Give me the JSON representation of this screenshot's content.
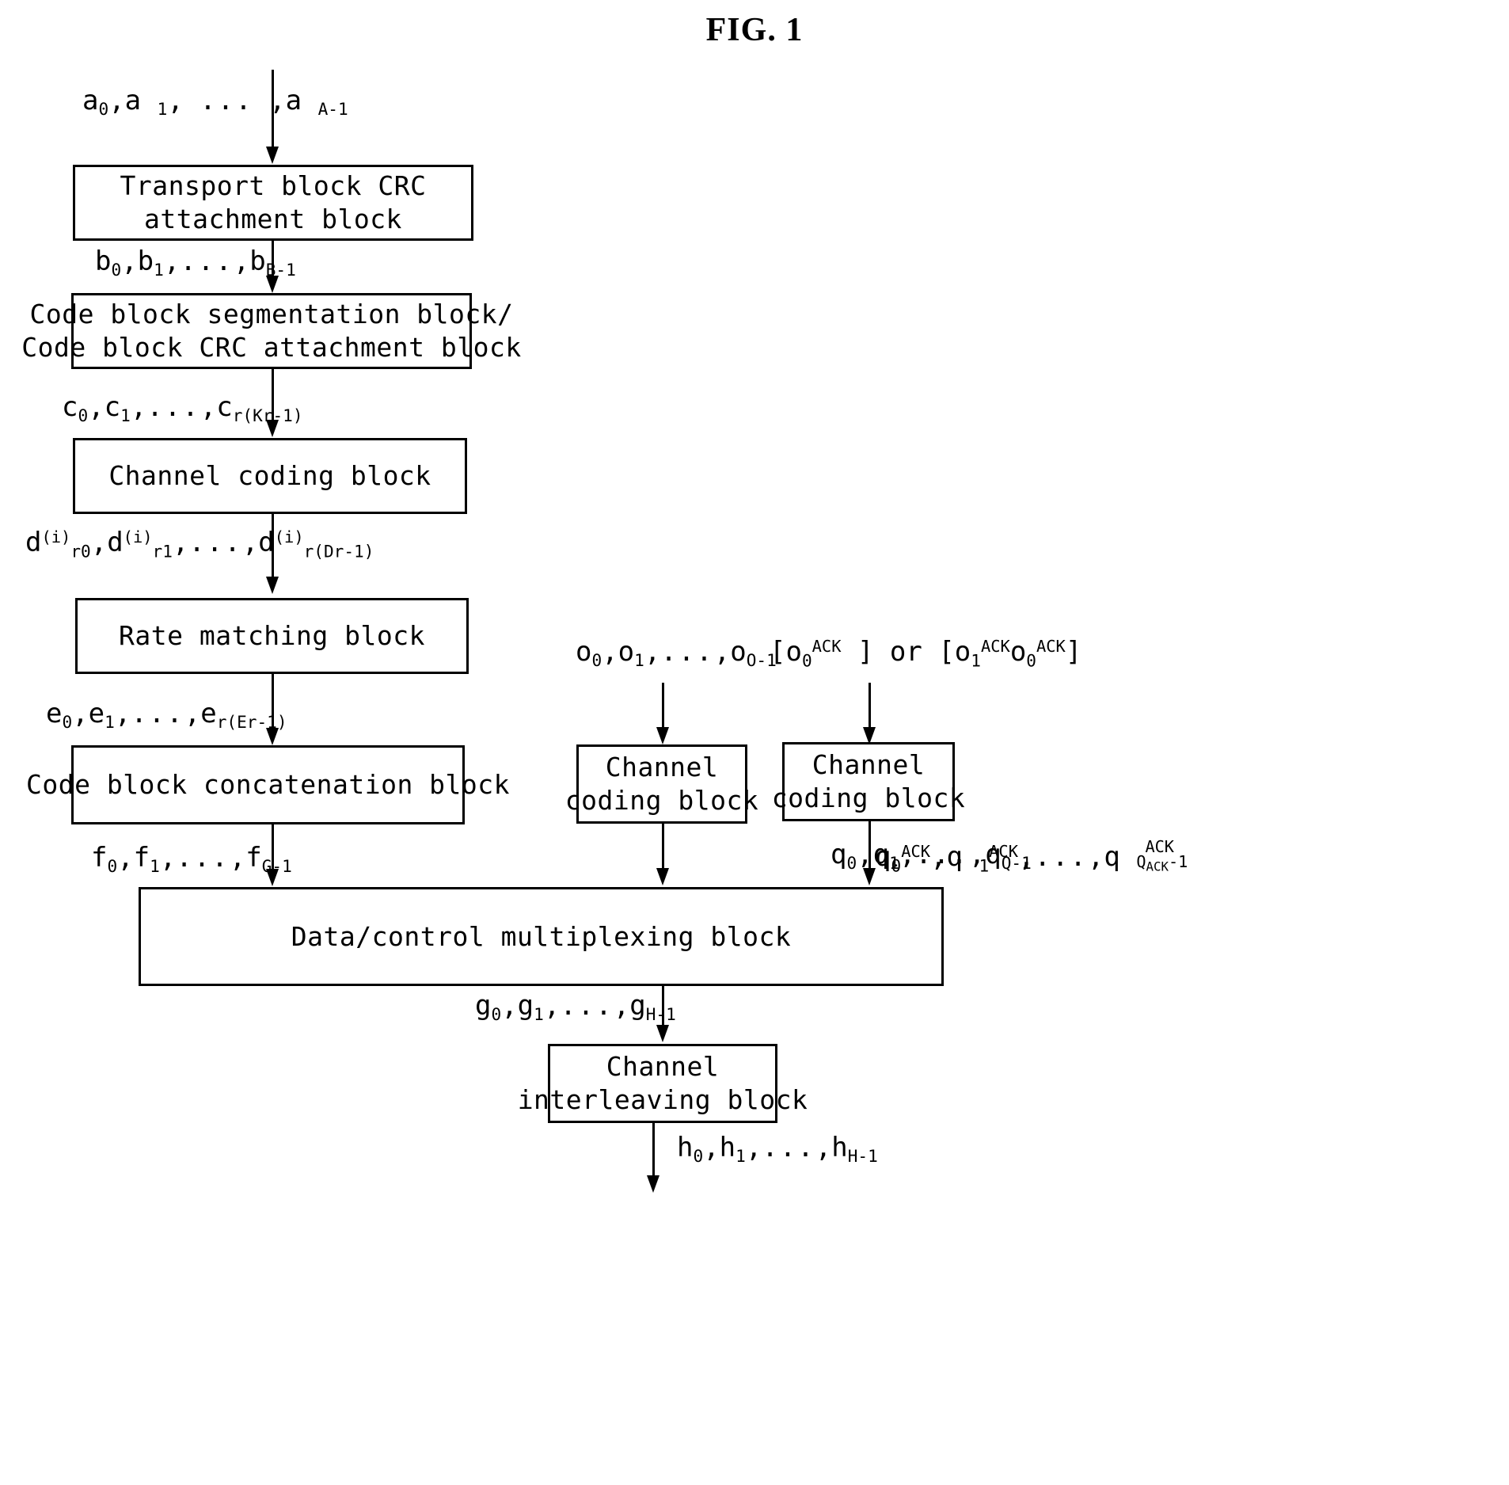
{
  "figure": {
    "title": "FIG. 1",
    "kind": "block-diagram",
    "subject": "Uplink transport channel processing chain with data/control multiplexing"
  },
  "blocks": {
    "transport_crc": {
      "line1": "Transport block CRC",
      "line2": "attachment block"
    },
    "code_block_seg": {
      "line1": "Code block segmentation block/",
      "line2": "Code block CRC attachment block"
    },
    "channel_coding_main": {
      "line1": "Channel coding block",
      "line2": ""
    },
    "rate_matching": {
      "line1": "Rate matching block",
      "line2": ""
    },
    "code_block_concat": {
      "line1": "Code block concatenation block",
      "line2": ""
    },
    "channel_coding_cqi": {
      "line1": "Channel",
      "line2": "coding block"
    },
    "channel_coding_ack": {
      "line1": "Channel",
      "line2": "coding block"
    },
    "data_control_mux": {
      "line1": "Data/control multiplexing block",
      "line2": ""
    },
    "channel_interleaving": {
      "line1": "Channel",
      "line2": "interleaving block"
    }
  },
  "signals": {
    "a": {
      "plain": "a0,a1, ... ,aA-1"
    },
    "b": {
      "plain": "b0,b1,...,bB-1"
    },
    "c": {
      "plain": "c0,c1,...,cr(Kr-1)"
    },
    "d": {
      "plain": "d(i)r0,d(i)r1,...,d(i)r(Dr-1)"
    },
    "e": {
      "plain": "e0,e1,...,er(Er-1)"
    },
    "f": {
      "plain": "f0,f1,...,fG-1"
    },
    "o": {
      "plain": "o0,o1,...,oO-1"
    },
    "o_ack": {
      "plain": "[o0ACK ] or [o1ACK o0ACK]"
    },
    "q": {
      "plain": "q0,q1,...,qQ-1"
    },
    "q_ack": {
      "plain": "q0ACK,q1ACK,...,qQACK-1ACK"
    },
    "g": {
      "plain": "g0,g1,...,gH-1"
    },
    "h": {
      "plain": "h0,h1,...,hH-1"
    }
  },
  "colors": {
    "ink": "#000000",
    "paper": "#ffffff"
  }
}
